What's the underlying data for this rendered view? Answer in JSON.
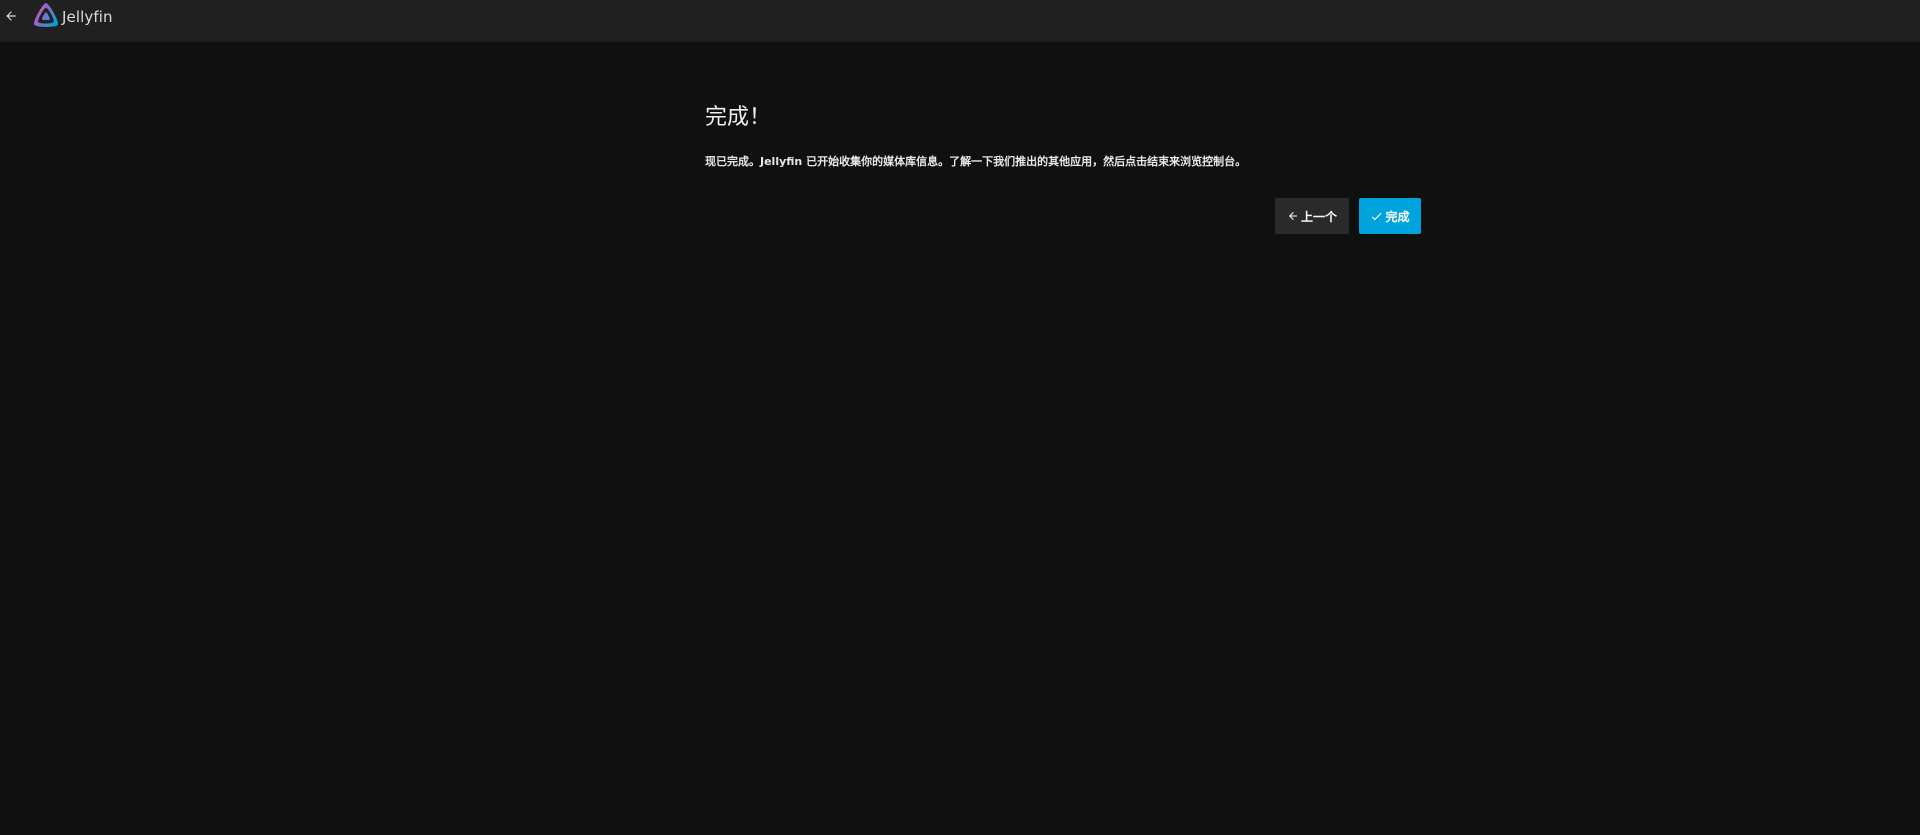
{
  "header": {
    "app_name": "Jellyfin",
    "icons": {
      "back": "arrow-left-icon",
      "logo": "jellyfin-logo-icon"
    },
    "colors": {
      "logo_gradient_start": "#aa5cc3",
      "logo_gradient_end": "#00a4dc"
    }
  },
  "wizard": {
    "title": "完成！",
    "description": "现已完成。Jellyfin 已开始收集你的媒体库信息。了解一下我们推出的其他应用，然后点击结束来浏览控制台。",
    "buttons": {
      "previous": {
        "label": "上一个",
        "icon": "arrow-left-icon",
        "color": "#2a2a2a"
      },
      "finish": {
        "label": "完成",
        "icon": "check-icon",
        "color": "#00a4dc"
      }
    }
  }
}
